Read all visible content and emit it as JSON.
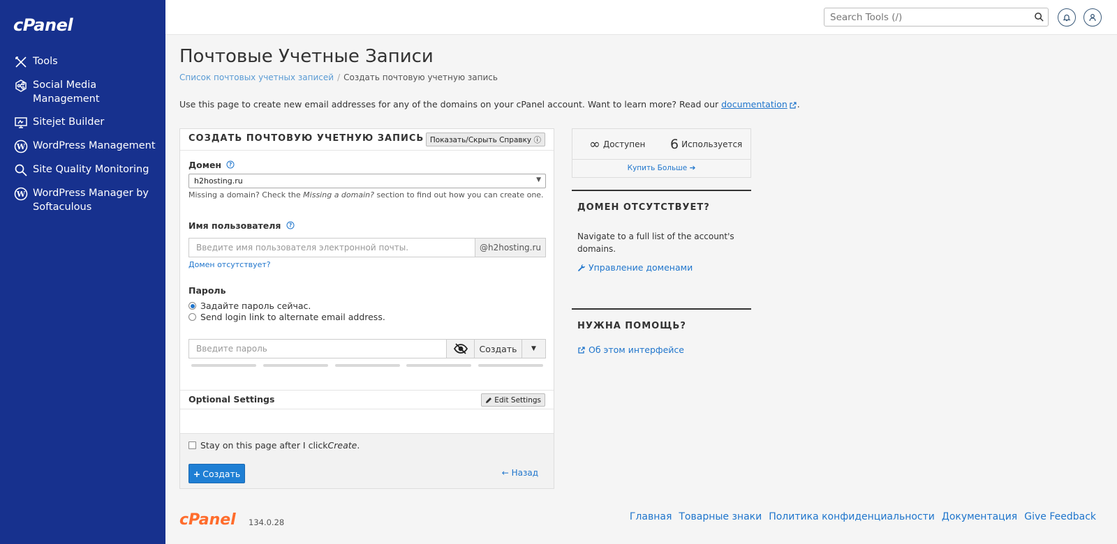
{
  "brand": {
    "logo_text": "cPanel",
    "version": "134.0.28"
  },
  "sidebar": {
    "items": [
      {
        "label": "Tools",
        "icon": "tools-icon"
      },
      {
        "label": "Social Media\nManagement",
        "icon": "social-media-icon"
      },
      {
        "label": "Sitejet Builder",
        "icon": "sitejet-icon"
      },
      {
        "label": "WordPress Management",
        "icon": "wordpress-icon"
      },
      {
        "label": "Site Quality Monitoring",
        "icon": "magnify-icon"
      },
      {
        "label": "WordPress Manager by\nSoftaculous",
        "icon": "wordpress-icon"
      }
    ]
  },
  "topbar": {
    "search_placeholder": "Search Tools (/)"
  },
  "page": {
    "title": "Почтовые Учетные Записи",
    "breadcrumb": {
      "parent": "Список почтовых учетных записей",
      "separator": "/",
      "current": "Создать почтовую учетную запись"
    },
    "intro_text": "Use this page to create new email addresses for any of the domains on your cPanel account. Want to learn more? Read our ",
    "intro_link": "documentation",
    "intro_end": "."
  },
  "form": {
    "title": "СОЗДАТЬ ПОЧТОВУЮ УЧЕТНУЮ ЗАПИСЬ",
    "help_toggle": "Показать/Скрыть Справку",
    "domain_label": "Домен",
    "domain_value": "h2hosting.ru",
    "domain_hint_pre": "Missing a domain? Check the ",
    "domain_hint_em": "Missing a domain?",
    "domain_hint_post": " section to find out how you can create one.",
    "username_label": "Имя пользователя",
    "username_placeholder": "Введите имя пользователя электронной почты.",
    "username_suffix": "@h2hosting.ru",
    "missing_domain_link": "Домен отсутствует?",
    "password_label": "Пароль",
    "radio_set_now": "Задайте пароль сейчас.",
    "radio_send_link": "Send login link to alternate email address.",
    "password_placeholder": "Введите пароль",
    "generate_label": "Создать",
    "optional_settings": "Optional Settings",
    "edit_settings": "Edit Settings",
    "stay_text_pre": "Stay on this page after I click ",
    "stay_text_em": "Create",
    "stay_text_post": ".",
    "create_button": "Создать",
    "back_link": "Назад"
  },
  "stats": {
    "available_value": "∞",
    "available_label": "Доступен",
    "used_value": "6",
    "used_label": "Используется",
    "buy_more": "Купить Больше"
  },
  "missing_domain": {
    "title": "ДОМЕН ОТСУТСТВУЕТ?",
    "text": "Navigate to a full list of the account's domains.",
    "link": "Управление доменами"
  },
  "need_help": {
    "title": "НУЖНА ПОМОЩЬ?",
    "link": "Об этом интерфейсе"
  },
  "footer": {
    "links": [
      "Главная",
      "Товарные знаки",
      "Политика конфиденциальности",
      "Документация",
      "Give Feedback"
    ]
  },
  "colors": {
    "sidebar_bg": "#17318e",
    "primary": "#1f7fd4",
    "link": "#1f75cc",
    "footer_logo": "#ff6c2c"
  }
}
